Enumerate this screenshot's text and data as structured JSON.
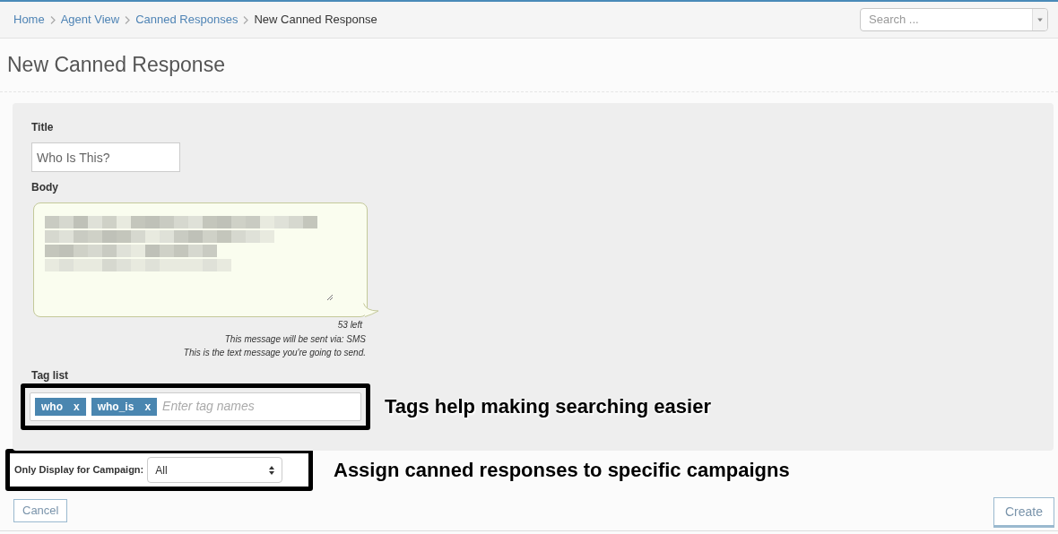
{
  "breadcrumb": [
    {
      "label": "Home",
      "current": false
    },
    {
      "label": "Agent View",
      "current": false
    },
    {
      "label": "Canned Responses",
      "current": false
    },
    {
      "label": "New Canned Response",
      "current": true
    }
  ],
  "search": {
    "placeholder": "Search ..."
  },
  "heading": "New Canned Response",
  "form": {
    "title": {
      "label": "Title",
      "value": "Who Is This?"
    },
    "body": {
      "label": "Body",
      "counter": "53 left",
      "notes": [
        "This message will be sent via: SMS",
        "This is the text message you're going to send."
      ]
    },
    "tags": {
      "label": "Tag list",
      "placeholder": "Enter tag names",
      "items": [
        {
          "label": "who",
          "remove": "x"
        },
        {
          "label": "who_is",
          "remove": "x"
        }
      ]
    }
  },
  "campaign": {
    "label": "Only Display for Campaign:",
    "value": "All"
  },
  "annotations": [
    "Tags help making searching easier",
    "Assign canned responses to specific campaigns"
  ],
  "buttons": {
    "cancel": "Cancel",
    "create": "Create"
  }
}
